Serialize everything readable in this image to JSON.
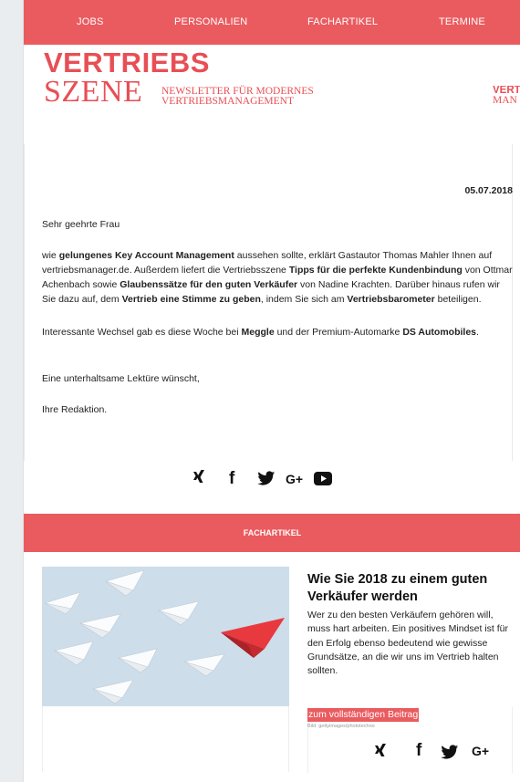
{
  "nav": {
    "items": [
      "JOBS",
      "PERSONALIEN",
      "FACHARTIKEL",
      "TERMINE"
    ]
  },
  "logo": {
    "line1": "VERTRIEBS",
    "line2": "SZENE",
    "tagline1": "NEWSLETTER FÜR MODERNES",
    "tagline2": "VERTRIEBSMANAGEMENT",
    "partner_line1": "VERT",
    "partner_line2": "MAN"
  },
  "date": "05.07.2018",
  "intro": {
    "greeting": "Sehr geehrte Frau",
    "p1_a": "wie ",
    "p1_b1": "gelungenes Key Account Management",
    "p1_c": " aussehen sollte, erklärt Gastautor Thomas Mahler Ihnen auf vertriebsmanager.de. Außerdem liefert die Vertriebsszene ",
    "p1_b2": "Tipps für die perfekte Kundenbindung",
    "p1_d": " von Ottmar Achenbach sowie ",
    "p1_b3": "Glaubenssätze für den guten Verkäufer",
    "p1_e": " von Nadine Krachten. Darüber hinaus rufen wir Sie dazu auf, dem ",
    "p1_b4": "Vertrieb eine Stimme zu geben",
    "p1_f": ", indem Sie sich am ",
    "p1_b5": "Vertriebsbarometer",
    "p1_g": " beteiligen.",
    "p2_a": "Interessante Wechsel gab es diese Woche bei ",
    "p2_b1": "Meggle",
    "p2_c": " und der Premium-Automarke ",
    "p2_b2": "DS Automobiles",
    "p2_d": ".",
    "closing": "Eine unterhaltsame Lektüre wünscht,",
    "signature": "Ihre Redaktion."
  },
  "social": {
    "xing": "Ⅹ",
    "facebook": "f",
    "twitter": "t",
    "googleplus": "G+",
    "youtube": "▶"
  },
  "section": {
    "title": "FACHARTIKEL"
  },
  "article": {
    "title": "Wie Sie 2018 zu einem guten Verkäufer werden",
    "text": "Wer zu den besten Verkäufern gehören will, muss hart arbeiten. Ein positives Mindset ist für den Erfolg ebenso bedeutend wie gewisse Grundsätze, an die wir uns im Vertrieb halten sollten.",
    "read_more": "zum vollständigen Beitrag",
    "credit": "Bild: gettyimages/phototechno"
  },
  "colors": {
    "accent": "#ea5b5f",
    "logo": "#e84f55",
    "background": "#e9edef"
  }
}
